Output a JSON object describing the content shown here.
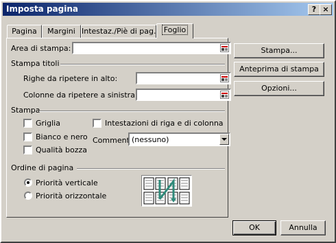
{
  "window": {
    "title": "Imposta pagina",
    "help_label": "?",
    "close_label": "×"
  },
  "tabs": [
    {
      "label": "Pagina"
    },
    {
      "label": "Margini"
    },
    {
      "label": "Intestaz./Piè di pag."
    },
    {
      "label": "Foglio"
    }
  ],
  "print_area": {
    "label": "Area di stampa:",
    "value": ""
  },
  "print_titles": {
    "heading": "Stampa titoli",
    "rows_label": "Righe da ripetere in alto:",
    "rows_value": "",
    "cols_label": "Colonne da ripetere a sinistra:",
    "cols_value": ""
  },
  "print": {
    "heading": "Stampa",
    "gridlines": {
      "label": "Griglia",
      "checked": false
    },
    "black_white": {
      "label": "Bianco e nero",
      "checked": false
    },
    "draft": {
      "label": "Qualità bozza",
      "checked": false
    },
    "headings": {
      "label": "Intestazioni di riga e di colonna",
      "checked": false
    },
    "comments_label": "Commenti",
    "comments_value": "(nessuno)"
  },
  "page_order": {
    "heading": "Ordine di pagina",
    "down_then_over": {
      "label": "Priorità verticale",
      "selected": true
    },
    "over_then_down": {
      "label": "Priorità orizzontale",
      "selected": false
    }
  },
  "side_buttons": {
    "print": "Stampa...",
    "preview": "Anteprima di stampa",
    "options": "Opzioni..."
  },
  "footer": {
    "ok": "OK",
    "cancel": "Annulla"
  },
  "icons": {
    "range_selector": "range-collapse-icon",
    "dropdown": "chevron-down-icon"
  },
  "colors": {
    "face": "#d4d0c8",
    "title_start": "#0a246a",
    "title_end": "#a6caf0",
    "arrow": "#2f8a7a"
  }
}
